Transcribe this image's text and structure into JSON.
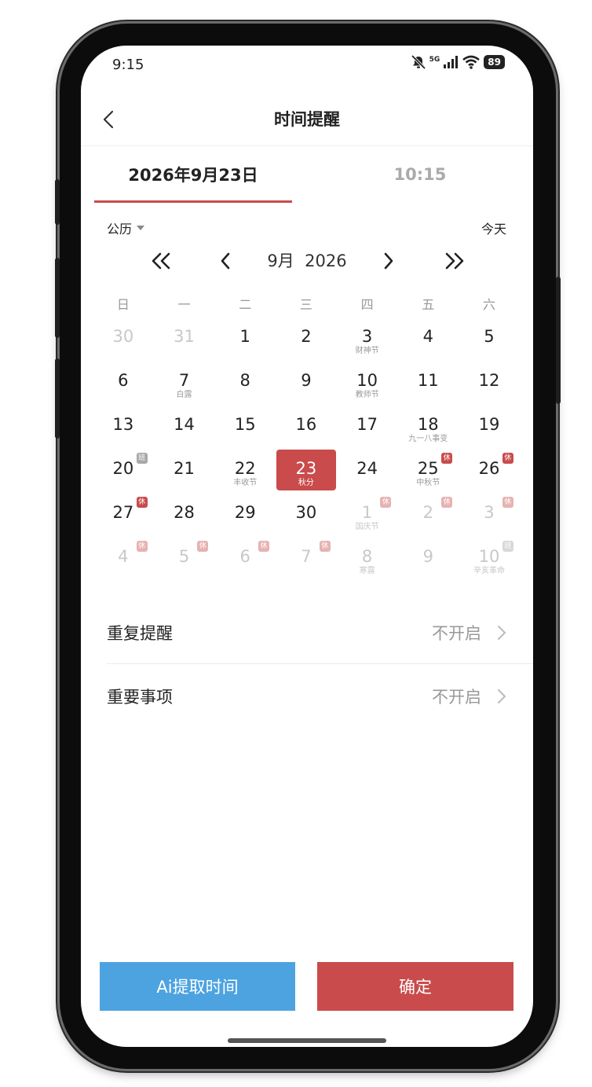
{
  "status_bar": {
    "time": "9:15",
    "battery": "89",
    "network": "5G"
  },
  "header": {
    "title": "时间提醒"
  },
  "tabs": {
    "date": "2026年9月23日",
    "time": "10:15"
  },
  "calendar": {
    "type_label": "公历",
    "today_label": "今天",
    "month_label": "9月  2026",
    "weekdays": [
      "日",
      "一",
      "二",
      "三",
      "四",
      "五",
      "六"
    ],
    "days": [
      {
        "n": "30",
        "sub": "",
        "faded": true,
        "badge": "",
        "selected": false
      },
      {
        "n": "31",
        "sub": "",
        "faded": true,
        "badge": "",
        "selected": false
      },
      {
        "n": "1",
        "sub": "",
        "faded": false,
        "badge": "",
        "selected": false
      },
      {
        "n": "2",
        "sub": "",
        "faded": false,
        "badge": "",
        "selected": false
      },
      {
        "n": "3",
        "sub": "财神节",
        "faded": false,
        "badge": "",
        "selected": false
      },
      {
        "n": "4",
        "sub": "",
        "faded": false,
        "badge": "",
        "selected": false
      },
      {
        "n": "5",
        "sub": "",
        "faded": false,
        "badge": "",
        "selected": false
      },
      {
        "n": "6",
        "sub": "",
        "faded": false,
        "badge": "",
        "selected": false
      },
      {
        "n": "7",
        "sub": "白露",
        "faded": false,
        "badge": "",
        "selected": false
      },
      {
        "n": "8",
        "sub": "",
        "faded": false,
        "badge": "",
        "selected": false
      },
      {
        "n": "9",
        "sub": "",
        "faded": false,
        "badge": "",
        "selected": false
      },
      {
        "n": "10",
        "sub": "教师节",
        "faded": false,
        "badge": "",
        "selected": false
      },
      {
        "n": "11",
        "sub": "",
        "faded": false,
        "badge": "",
        "selected": false
      },
      {
        "n": "12",
        "sub": "",
        "faded": false,
        "badge": "",
        "selected": false
      },
      {
        "n": "13",
        "sub": "",
        "faded": false,
        "badge": "",
        "selected": false
      },
      {
        "n": "14",
        "sub": "",
        "faded": false,
        "badge": "",
        "selected": false
      },
      {
        "n": "15",
        "sub": "",
        "faded": false,
        "badge": "",
        "selected": false
      },
      {
        "n": "16",
        "sub": "",
        "faded": false,
        "badge": "",
        "selected": false
      },
      {
        "n": "17",
        "sub": "",
        "faded": false,
        "badge": "",
        "selected": false
      },
      {
        "n": "18",
        "sub": "九一八事变",
        "faded": false,
        "badge": "",
        "selected": false
      },
      {
        "n": "19",
        "sub": "",
        "faded": false,
        "badge": "",
        "selected": false
      },
      {
        "n": "20",
        "sub": "",
        "faded": false,
        "badge": "班",
        "selected": false
      },
      {
        "n": "21",
        "sub": "",
        "faded": false,
        "badge": "",
        "selected": false
      },
      {
        "n": "22",
        "sub": "丰收节",
        "faded": false,
        "badge": "",
        "selected": false
      },
      {
        "n": "23",
        "sub": "秋分",
        "faded": false,
        "badge": "",
        "selected": true
      },
      {
        "n": "24",
        "sub": "",
        "faded": false,
        "badge": "",
        "selected": false
      },
      {
        "n": "25",
        "sub": "中秋节",
        "faded": false,
        "badge": "休",
        "selected": false
      },
      {
        "n": "26",
        "sub": "",
        "faded": false,
        "badge": "休",
        "selected": false
      },
      {
        "n": "27",
        "sub": "",
        "faded": false,
        "badge": "休",
        "selected": false
      },
      {
        "n": "28",
        "sub": "",
        "faded": false,
        "badge": "",
        "selected": false
      },
      {
        "n": "29",
        "sub": "",
        "faded": false,
        "badge": "",
        "selected": false
      },
      {
        "n": "30",
        "sub": "",
        "faded": false,
        "badge": "",
        "selected": false
      },
      {
        "n": "1",
        "sub": "国庆节",
        "faded": true,
        "badge": "休",
        "selected": false
      },
      {
        "n": "2",
        "sub": "",
        "faded": true,
        "badge": "休",
        "selected": false
      },
      {
        "n": "3",
        "sub": "",
        "faded": true,
        "badge": "休",
        "selected": false
      },
      {
        "n": "4",
        "sub": "",
        "faded": true,
        "badge": "休",
        "selected": false
      },
      {
        "n": "5",
        "sub": "",
        "faded": true,
        "badge": "休",
        "selected": false
      },
      {
        "n": "6",
        "sub": "",
        "faded": true,
        "badge": "休",
        "selected": false
      },
      {
        "n": "7",
        "sub": "",
        "faded": true,
        "badge": "休",
        "selected": false
      },
      {
        "n": "8",
        "sub": "寒露",
        "faded": true,
        "badge": "",
        "selected": false
      },
      {
        "n": "9",
        "sub": "",
        "faded": true,
        "badge": "",
        "selected": false
      },
      {
        "n": "10",
        "sub": "辛亥革命",
        "faded": true,
        "badge": "班",
        "selected": false
      }
    ]
  },
  "settings": [
    {
      "label": "重复提醒",
      "value": "不开启"
    },
    {
      "label": "重要事项",
      "value": "不开启"
    }
  ],
  "buttons": {
    "ai": "Ai提取时间",
    "confirm": "确定"
  },
  "colors": {
    "accent": "#c94b4b",
    "ai_button": "#4da3e0"
  },
  "icons": {
    "back": "chevron-left-icon",
    "prev_year": "double-chevron-left-icon",
    "prev_month": "chevron-left-icon",
    "next_month": "chevron-right-icon",
    "next_year": "double-chevron-right-icon",
    "setting_arrow": "chevron-right-icon"
  }
}
